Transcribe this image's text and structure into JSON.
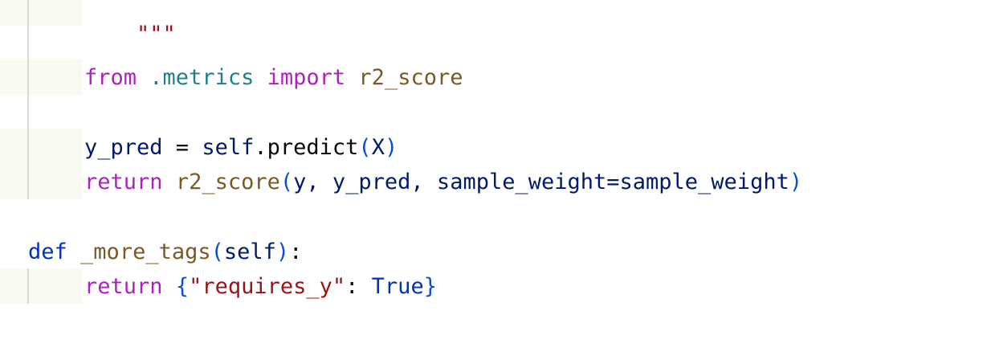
{
  "code": {
    "line_docstring_end": "\"\"\"",
    "line_import": {
      "kw_from": "from",
      "module": ".metrics",
      "kw_import": "import",
      "name": "r2_score"
    },
    "line_pred": {
      "var": "y_pred",
      "op": " = ",
      "self": "self",
      "dot": ".",
      "method": "predict",
      "open": "(",
      "arg": "X",
      "close": ")"
    },
    "line_return_score": {
      "kw": "return",
      "func": "r2_score",
      "open": "(",
      "args": "y, y_pred, sample_weight=sample_weight",
      "close": ")"
    },
    "line_def": {
      "kw": "def",
      "name": "_more_tags",
      "open": "(",
      "param": "self",
      "close": ")",
      "colon": ":"
    },
    "line_return_tags": {
      "kw": "return",
      "open": "{",
      "key": "\"requires_y\"",
      "colon": ": ",
      "value": "True",
      "close": "}"
    }
  }
}
